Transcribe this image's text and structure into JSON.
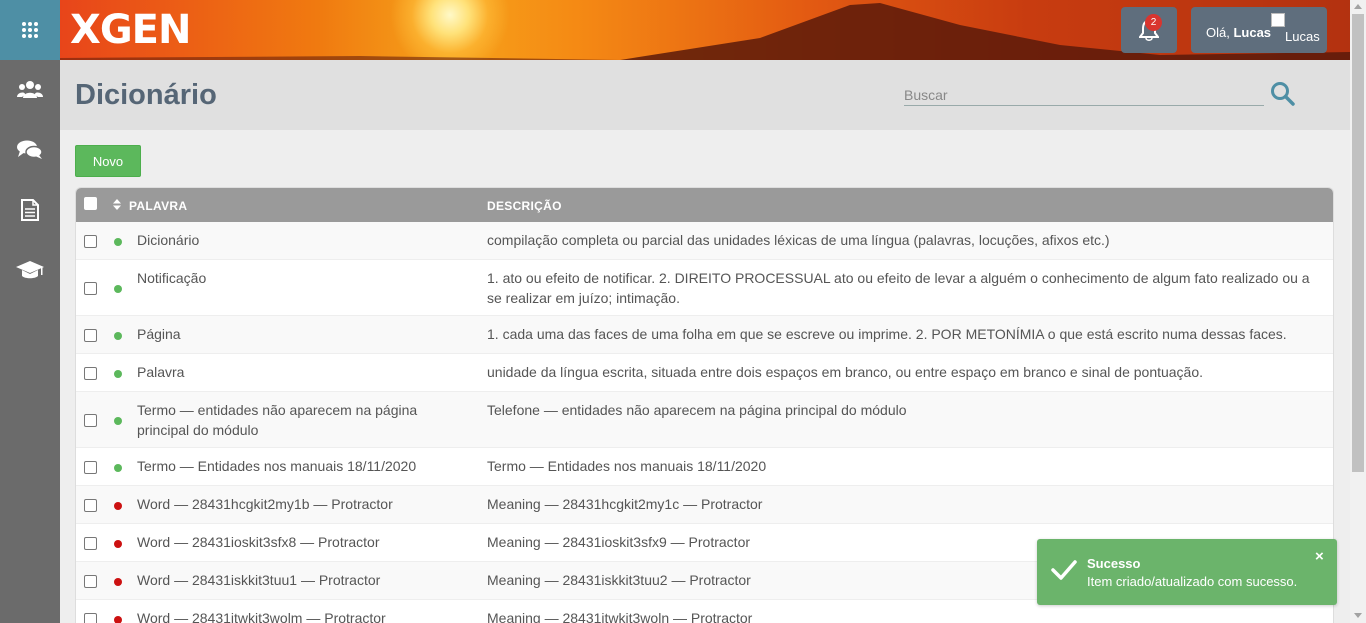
{
  "brand": {
    "logo": "XGEN"
  },
  "sidebar": {
    "items": [
      {
        "icon": "apps-grid-icon"
      },
      {
        "icon": "users-icon"
      },
      {
        "icon": "chat-icon"
      },
      {
        "icon": "document-icon"
      },
      {
        "icon": "graduation-cap-icon"
      }
    ]
  },
  "header": {
    "notification_count": "2",
    "user_greeting": "Olá,",
    "user_name": "Lucas",
    "avatar_alt": "Lucas"
  },
  "page": {
    "title": "Dicionário",
    "search_placeholder": "Buscar",
    "new_button": "Novo"
  },
  "table": {
    "headers": {
      "word": "PALAVRA",
      "description": "DESCRIÇÃO"
    },
    "rows": [
      {
        "status": "active",
        "word": "Dicionário",
        "description": "compilação completa ou parcial das unidades léxicas de uma língua (palavras, locuções, afixos etc.)"
      },
      {
        "status": "active",
        "word": "Notificação",
        "description": "1. ato ou efeito de notificar. 2. DIREITO PROCESSUAL ato ou efeito de levar a alguém o conhecimento de algum fato realizado ou a se realizar em juízo; intimação."
      },
      {
        "status": "active",
        "word": "Página",
        "description": "1. cada uma das faces de uma folha em que se escreve ou imprime. 2. POR METONÍMIA o que está escrito numa dessas faces."
      },
      {
        "status": "active",
        "word": "Palavra",
        "description": "unidade da língua escrita, situada entre dois espaços em branco, ou entre espaço em branco e sinal de pontuação."
      },
      {
        "status": "active",
        "word": "Termo — entidades não aparecem na página principal do módulo",
        "description": "Telefone — entidades não aparecem na página principal do módulo"
      },
      {
        "status": "active",
        "word": "Termo — Entidades nos manuais 18/11/2020",
        "description": "Termo — Entidades nos manuais 18/11/2020"
      },
      {
        "status": "inactive",
        "word": "Word — 28431hcgkit2my1b — Protractor",
        "description": "Meaning — 28431hcgkit2my1c — Protractor"
      },
      {
        "status": "inactive",
        "word": "Word — 28431ioskit3sfx8 — Protractor",
        "description": "Meaning — 28431ioskit3sfx9 — Protractor"
      },
      {
        "status": "inactive",
        "word": "Word — 28431iskkit3tuu1 — Protractor",
        "description": "Meaning — 28431iskkit3tuu2 — Protractor"
      },
      {
        "status": "inactive",
        "word": "Word — 28431itwkit3wolm — Protractor",
        "description": "Meaning — 28431itwkit3woln — Protractor"
      }
    ]
  },
  "toast": {
    "title": "Sucesso",
    "message": "Item criado/atualizado com sucesso.",
    "close_label": "×"
  },
  "colors": {
    "active_status": "#5cb85c",
    "inactive_status": "#cc1111",
    "sidebar_top": "#4e8fa5",
    "toast_success": "#6bb46b"
  }
}
